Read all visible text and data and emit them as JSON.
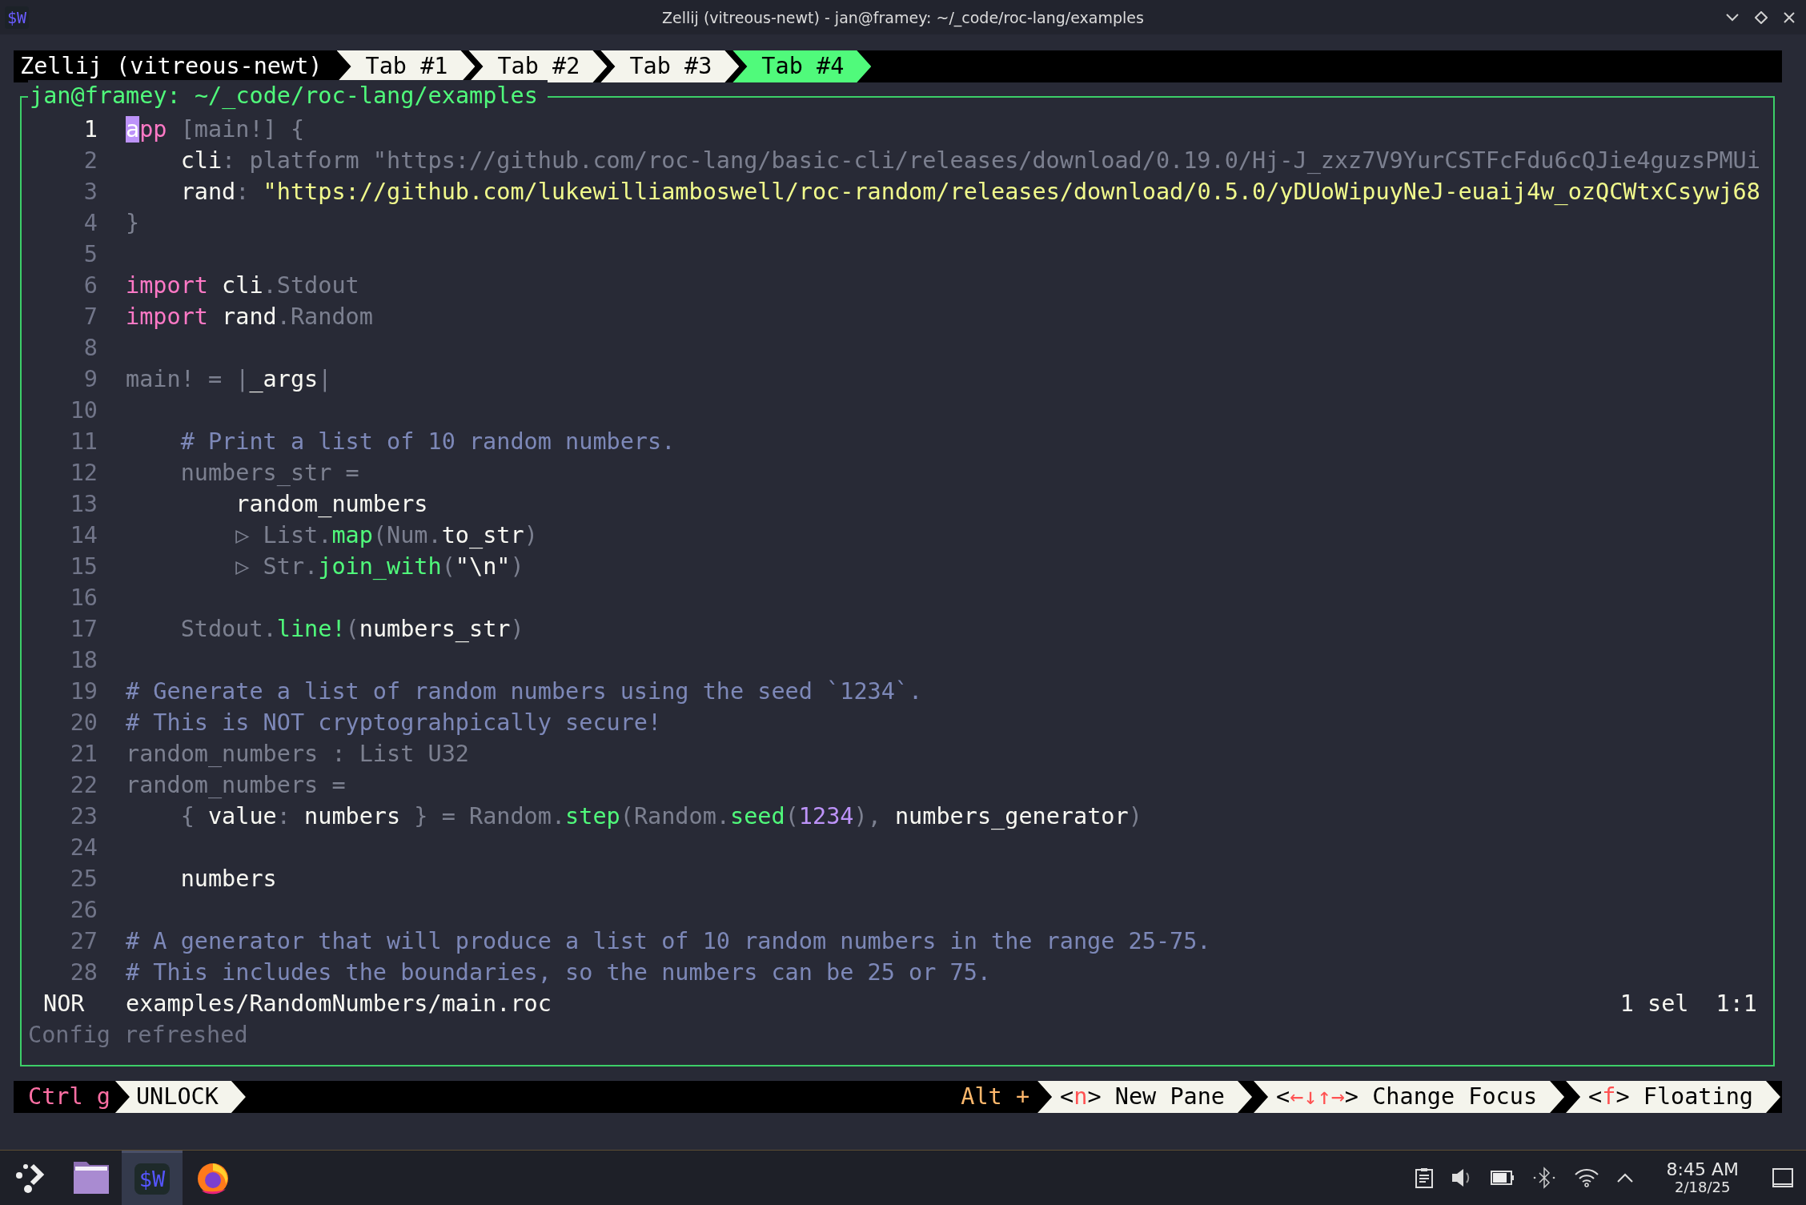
{
  "window": {
    "app_icon": "$W",
    "title": "Zellij (vitreous-newt) - jan@framey: ~/_code/roc-lang/examples"
  },
  "session": {
    "name": "Zellij (vitreous-newt)"
  },
  "tabs": [
    {
      "label": "Tab #1",
      "selected": false
    },
    {
      "label": "Tab #2",
      "selected": false
    },
    {
      "label": "Tab #3",
      "selected": false
    },
    {
      "label": "Tab #4",
      "selected": true
    }
  ],
  "pane": {
    "title": "jan@framey: ~/_code/roc-lang/examples",
    "lines": [
      {
        "number": "1",
        "current": true,
        "tokens": [
          {
            "t": "a",
            "kind": "cursor"
          },
          {
            "t": "pp",
            "kind": "keyword"
          },
          {
            "t": " [main!] {",
            "kind": "dim"
          }
        ]
      },
      {
        "number": "2",
        "current": false,
        "tokens": [
          {
            "t": "    cli",
            "kind": "plain"
          },
          {
            "t": ": platform \"https://github.com/roc-lang/basic-cli/releases/download/0.19.0/Hj-J_zxz7V9YurCSTFcFdu6cQJie4guzsPMUi",
            "kind": "dim"
          }
        ]
      },
      {
        "number": "3",
        "current": false,
        "tokens": [
          {
            "t": "    rand",
            "kind": "plain"
          },
          {
            "t": ": ",
            "kind": "dim"
          },
          {
            "t": "\"https://github.com/lukewilliamboswell/roc-random/releases/download/0.5.0/yDUoWipuyNeJ-euaij4w_ozQCWtxCsywj68",
            "kind": "string"
          }
        ]
      },
      {
        "number": "4",
        "current": false,
        "tokens": [
          {
            "t": "}",
            "kind": "dim"
          }
        ]
      },
      {
        "number": "5",
        "current": false
      },
      {
        "number": "6",
        "current": false,
        "tokens": [
          {
            "t": "import",
            "kind": "keyword"
          },
          {
            "t": " cli",
            "kind": "plain"
          },
          {
            "t": ".Stdout",
            "kind": "dim"
          }
        ]
      },
      {
        "number": "7",
        "current": false,
        "tokens": [
          {
            "t": "import",
            "kind": "keyword"
          },
          {
            "t": " rand",
            "kind": "plain"
          },
          {
            "t": ".Random",
            "kind": "dim"
          }
        ]
      },
      {
        "number": "8",
        "current": false
      },
      {
        "number": "9",
        "current": false,
        "tokens": [
          {
            "t": "main! = |",
            "kind": "dim"
          },
          {
            "t": "_args",
            "kind": "plain"
          },
          {
            "t": "|",
            "kind": "dim"
          }
        ]
      },
      {
        "number": "10",
        "current": false
      },
      {
        "number": "11",
        "current": false,
        "tokens": [
          {
            "t": "    # Print a list of 10 random numbers.",
            "kind": "comment"
          }
        ]
      },
      {
        "number": "12",
        "current": false,
        "tokens": [
          {
            "t": "    numbers_str =",
            "kind": "dim"
          }
        ]
      },
      {
        "number": "13",
        "current": false,
        "tokens": [
          {
            "t": "        random_numbers",
            "kind": "plain"
          }
        ]
      },
      {
        "number": "14",
        "current": false,
        "tokens": [
          {
            "t": "        ▷ List.",
            "kind": "dim"
          },
          {
            "t": "map",
            "kind": "function"
          },
          {
            "t": "(Num.",
            "kind": "dim"
          },
          {
            "t": "to_str",
            "kind": "plain"
          },
          {
            "t": ")",
            "kind": "dim"
          }
        ]
      },
      {
        "number": "15",
        "current": false,
        "tokens": [
          {
            "t": "        ▷ Str.",
            "kind": "dim"
          },
          {
            "t": "join_with",
            "kind": "function"
          },
          {
            "t": "(",
            "kind": "dim"
          },
          {
            "t": "\"\\n\"",
            "kind": "plain"
          },
          {
            "t": ")",
            "kind": "dim"
          }
        ]
      },
      {
        "number": "16",
        "current": false
      },
      {
        "number": "17",
        "current": false,
        "tokens": [
          {
            "t": "    Stdout.",
            "kind": "dim"
          },
          {
            "t": "line!",
            "kind": "function"
          },
          {
            "t": "(",
            "kind": "dim"
          },
          {
            "t": "numbers_str",
            "kind": "plain"
          },
          {
            "t": ")",
            "kind": "dim"
          }
        ]
      },
      {
        "number": "18",
        "current": false
      },
      {
        "number": "19",
        "current": false,
        "tokens": [
          {
            "t": "# Generate a list of random numbers using the seed `1234`.",
            "kind": "comment"
          }
        ]
      },
      {
        "number": "20",
        "current": false,
        "tokens": [
          {
            "t": "# This is NOT cryptograhpically secure!",
            "kind": "comment"
          }
        ]
      },
      {
        "number": "21",
        "current": false,
        "tokens": [
          {
            "t": "random_numbers : List U32",
            "kind": "dim"
          }
        ]
      },
      {
        "number": "22",
        "current": false,
        "tokens": [
          {
            "t": "random_numbers =",
            "kind": "dim"
          }
        ]
      },
      {
        "number": "23",
        "current": false,
        "tokens": [
          {
            "t": "    { ",
            "kind": "dim"
          },
          {
            "t": "value",
            "kind": "plain"
          },
          {
            "t": ": ",
            "kind": "dim"
          },
          {
            "t": "numbers",
            "kind": "plain"
          },
          {
            "t": " } = Random.",
            "kind": "dim"
          },
          {
            "t": "step",
            "kind": "function"
          },
          {
            "t": "(Random.",
            "kind": "dim"
          },
          {
            "t": "seed",
            "kind": "function"
          },
          {
            "t": "(",
            "kind": "dim"
          },
          {
            "t": "1234",
            "kind": "number"
          },
          {
            "t": "), ",
            "kind": "dim"
          },
          {
            "t": "numbers_generator",
            "kind": "plain"
          },
          {
            "t": ")",
            "kind": "dim"
          }
        ]
      },
      {
        "number": "24",
        "current": false
      },
      {
        "number": "25",
        "current": false,
        "tokens": [
          {
            "t": "    numbers",
            "kind": "plain"
          }
        ]
      },
      {
        "number": "26",
        "current": false
      },
      {
        "number": "27",
        "current": false,
        "tokens": [
          {
            "t": "# A generator that will produce a list of 10 random numbers in the range 25-75.",
            "kind": "comment"
          }
        ]
      },
      {
        "number": "28",
        "current": false,
        "tokens": [
          {
            "t": "# This includes the boundaries, so the numbers can be 25 or 75.",
            "kind": "comment"
          }
        ]
      }
    ],
    "status": {
      "mode": "NOR",
      "file": "examples/RandomNumbers/main.roc",
      "selections": "1 sel",
      "position": "1:1"
    },
    "message": "Config refreshed"
  },
  "status_bar": {
    "lock_key": "Ctrl g",
    "lock_label": "UNLOCK",
    "modifier": "Alt +",
    "hints": [
      {
        "open": "<",
        "key": "n",
        "close": ">",
        "label": "New Pane"
      },
      {
        "open": "<",
        "key": "←↓↑→",
        "close": ">",
        "label": "Change Focus"
      },
      {
        "open": "<",
        "key": "f",
        "close": ">",
        "label": "Floating"
      }
    ]
  },
  "taskbar": {
    "apps": [
      {
        "kind": "launcher",
        "selected": false
      },
      {
        "kind": "files",
        "selected": false
      },
      {
        "kind": "terminal",
        "label": "$W",
        "selected": true
      },
      {
        "kind": "browser",
        "selected": false
      }
    ],
    "time": "8:45 AM",
    "date": "2/18/25"
  }
}
